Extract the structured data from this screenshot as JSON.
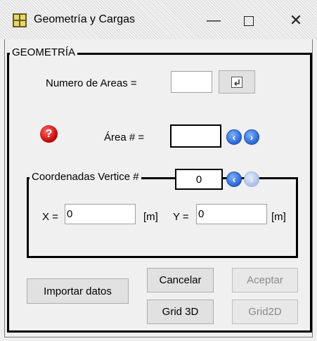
{
  "window": {
    "title": "Geometría y Cargas",
    "controls": {
      "minimize": "—",
      "maximize": "",
      "close": "✕"
    }
  },
  "geometry": {
    "group_label": "GEOMETRÍA",
    "num_areas_label": "Numero de Areas =",
    "num_areas_value": "",
    "num_areas_button_icon": "enter-icon",
    "area_label": "Área # =",
    "area_value": "",
    "help_icon": "help-icon",
    "nav_prev": "‹",
    "nav_next": "›"
  },
  "coordinates": {
    "group_label": "Coordenadas Vertice #",
    "vertex_value": "0",
    "x_label": "X =",
    "x_value": "0",
    "x_unit": "[m]",
    "y_label": "Y =",
    "y_value": "0",
    "y_unit": "[m]"
  },
  "actions": {
    "import_label": "Importar datos",
    "cancel_label": "Cancelar",
    "accept_label": "Aceptar",
    "grid3d_label": "Grid 3D",
    "grid2d_label": "Grid2D"
  },
  "colors": {
    "nav_blue": "#2a64d6",
    "help_red": "#c00000",
    "app_icon": "#e6d774"
  }
}
